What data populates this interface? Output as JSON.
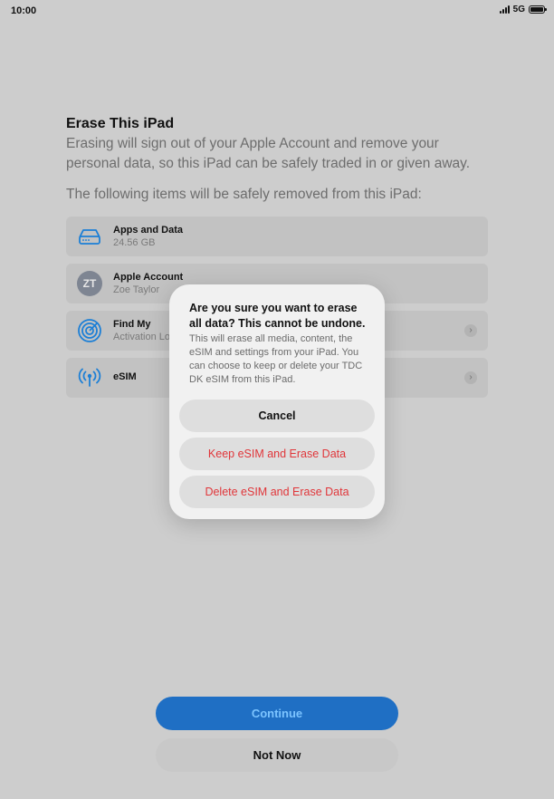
{
  "status": {
    "time": "10:00",
    "network": "5G"
  },
  "page": {
    "title": "Erase This iPad",
    "description": "Erasing will sign out of your Apple Account and remove your personal data, so this iPad can be safely traded in or given away.",
    "subheading": "The following items will be safely removed from this iPad:"
  },
  "items": [
    {
      "label": "Apps and Data",
      "sub": "24.56 GB",
      "icon": "storage-icon"
    },
    {
      "label": "Apple Account",
      "sub": "Zoe Taylor",
      "avatar": "ZT"
    },
    {
      "label": "Find My",
      "sub": "Activation Lo",
      "icon": "find-my-icon"
    },
    {
      "label": "eSIM",
      "icon": "esim-antenna-icon"
    }
  ],
  "buttons": {
    "continue": "Continue",
    "not_now": "Not Now"
  },
  "alert": {
    "title": "Are you sure you want to erase all data? This cannot be undone.",
    "message": "This will erase all media, content, the eSIM and settings from your iPad. You can choose to keep or delete your TDC DK eSIM from this iPad.",
    "cancel": "Cancel",
    "keep": "Keep eSIM and Erase Data",
    "delete": "Delete eSIM and Erase Data"
  },
  "colors": {
    "accent": "#1f6fc4",
    "destructive": "#e0363a",
    "icon_blue": "#1c7fd6"
  }
}
